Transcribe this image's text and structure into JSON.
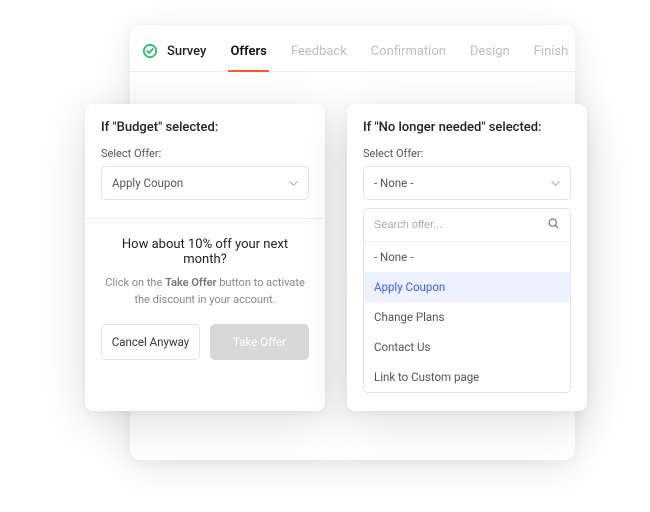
{
  "tabs": {
    "survey": "Survey",
    "offers": "Offers",
    "feedback": "Feedback",
    "confirmation": "Confirmation",
    "design": "Design",
    "finish": "Finish"
  },
  "left": {
    "title": "If \"Budget\" selected:",
    "label": "Select Offer:",
    "selected": "Apply Coupon",
    "offer_heading": "How about 10% off your next month?",
    "offer_body_pre": "Click on the ",
    "offer_body_bold": "Take Offer",
    "offer_body_post": " button to activate the discount in your account.",
    "cancel": "Cancel Anyway",
    "take": "Take Offer"
  },
  "right": {
    "title": "If \"No longer needed\" selected:",
    "label": "Select Offer:",
    "selected": "- None -",
    "search_placeholder": "Search offer...",
    "options": {
      "none": "- None -",
      "apply_coupon": "Apply Coupon",
      "change_plans": "Change Plans",
      "contact_us": "Contact Us",
      "custom_page": "Link to Custom page"
    }
  }
}
